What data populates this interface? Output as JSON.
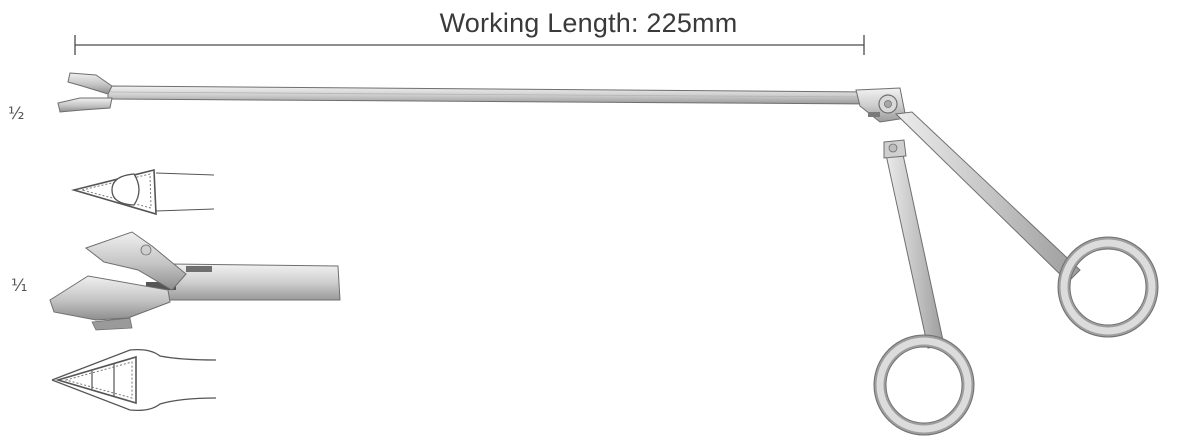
{
  "measurement": {
    "label": "Working Length: 225mm"
  },
  "scales": {
    "half": "½",
    "full": "⅟₁"
  },
  "colors": {
    "steel_light": "#e6e6e6",
    "steel_mid": "#bcbcbc",
    "steel_dark": "#8a8a8a",
    "outline": "#6f6f6f",
    "text": "#3a3a3a"
  },
  "icons": {
    "instrument": "rongeur-forceps-illustration",
    "jaw_profile_top": "jaw-cross-section-icon",
    "jaw_detail": "jaw-detail-illustration",
    "jaw_profile_bottom": "jaw-cross-section-icon"
  }
}
